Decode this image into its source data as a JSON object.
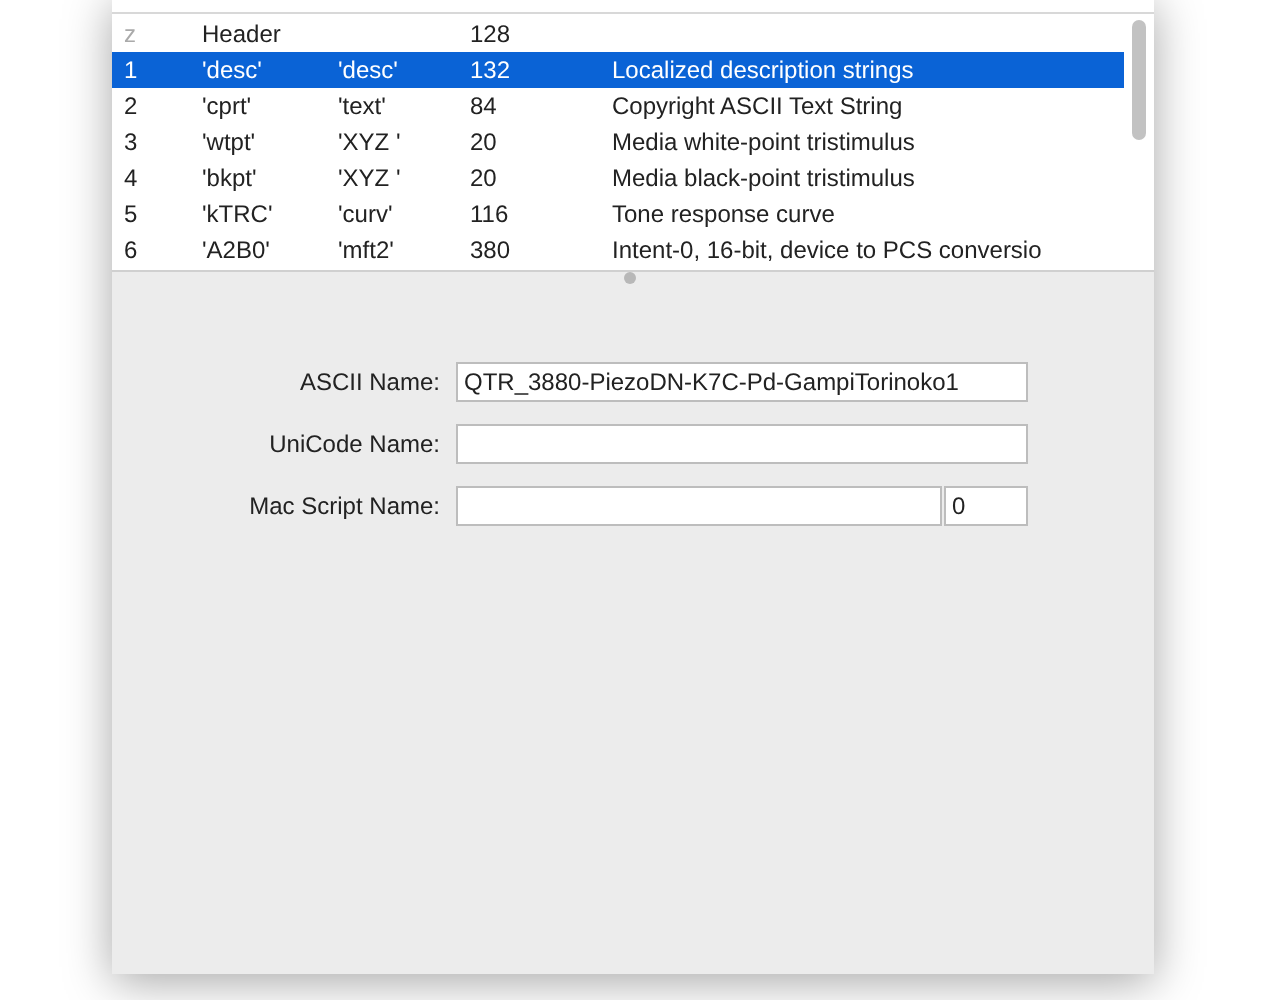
{
  "table": {
    "rows": [
      {
        "index": "z",
        "index_dimmed": true,
        "tag": "Header",
        "size": "128",
        "selected": false
      },
      {
        "index": "1",
        "index_dimmed": false,
        "tag": "'desc'",
        "data": "'desc'",
        "size": "132",
        "description": "Localized description strings",
        "selected": true
      },
      {
        "index": "2",
        "index_dimmed": false,
        "tag": "'cprt'",
        "data": "'text'",
        "size": "84",
        "description": "Copyright ASCII Text String",
        "selected": false
      },
      {
        "index": "3",
        "index_dimmed": false,
        "tag": "'wtpt'",
        "data": "'XYZ '",
        "size": "20",
        "description": "Media white-point tristimulus",
        "selected": false
      },
      {
        "index": "4",
        "index_dimmed": false,
        "tag": "'bkpt'",
        "data": "'XYZ '",
        "size": "20",
        "description": "Media black-point tristimulus",
        "selected": false
      },
      {
        "index": "5",
        "index_dimmed": false,
        "tag": "'kTRC'",
        "data": "'curv'",
        "size": "116",
        "description": "Tone response curve",
        "selected": false
      },
      {
        "index": "6",
        "index_dimmed": false,
        "tag": "'A2B0'",
        "data": "'mft2'",
        "size": "380",
        "description": "Intent-0, 16-bit, device to PCS conversio",
        "selected": false
      }
    ]
  },
  "form": {
    "fields": [
      {
        "label": "ASCII Name:",
        "value": "QTR_3880-PiezoDN-K7C-Pd-GampiTorinoko1"
      },
      {
        "label": "UniCode Name:"
      },
      {
        "label": "Mac Script Name:",
        "code": "0"
      }
    ]
  }
}
